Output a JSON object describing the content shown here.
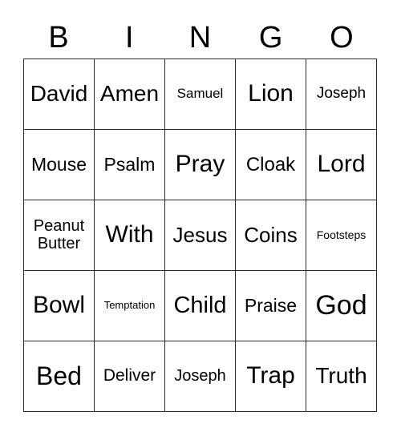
{
  "card": {
    "title": "Bingo Card",
    "columns": 5,
    "rows": 5,
    "background_color": "#ffffff",
    "border_color": "#2b2b2b",
    "text_color": "#000000"
  },
  "header": {
    "letters": [
      "B",
      "I",
      "N",
      "G",
      "O"
    ],
    "font_size": 38
  },
  "grid": {
    "rows": [
      {
        "cells": [
          {
            "text": "David",
            "font_size": 28
          },
          {
            "text": "Amen",
            "font_size": 28
          },
          {
            "text": "Samuel",
            "font_size": 17
          },
          {
            "text": "Lion",
            "font_size": 30
          },
          {
            "text": "Joseph",
            "font_size": 19
          }
        ]
      },
      {
        "cells": [
          {
            "text": "Mouse",
            "font_size": 23
          },
          {
            "text": "Psalm",
            "font_size": 23
          },
          {
            "text": "Pray",
            "font_size": 30
          },
          {
            "text": "Cloak",
            "font_size": 24
          },
          {
            "text": "Lord",
            "font_size": 30
          }
        ]
      },
      {
        "cells": [
          {
            "text": "Peanut Butter",
            "font_size": 20,
            "lines": [
              "Peanut",
              "Butter"
            ]
          },
          {
            "text": "With",
            "font_size": 30
          },
          {
            "text": "Jesus",
            "font_size": 26
          },
          {
            "text": "Coins",
            "font_size": 26
          },
          {
            "text": "Footsteps",
            "font_size": 14
          }
        ]
      },
      {
        "cells": [
          {
            "text": "Bowl",
            "font_size": 30
          },
          {
            "text": "Temptation",
            "font_size": 13
          },
          {
            "text": "Child",
            "font_size": 29
          },
          {
            "text": "Praise",
            "font_size": 23
          },
          {
            "text": "God",
            "font_size": 34
          }
        ]
      },
      {
        "cells": [
          {
            "text": "Bed",
            "font_size": 32
          },
          {
            "text": "Deliver",
            "font_size": 21
          },
          {
            "text": "Joseph",
            "font_size": 20
          },
          {
            "text": "Trap",
            "font_size": 30
          },
          {
            "text": "Truth",
            "font_size": 28
          }
        ]
      }
    ]
  }
}
